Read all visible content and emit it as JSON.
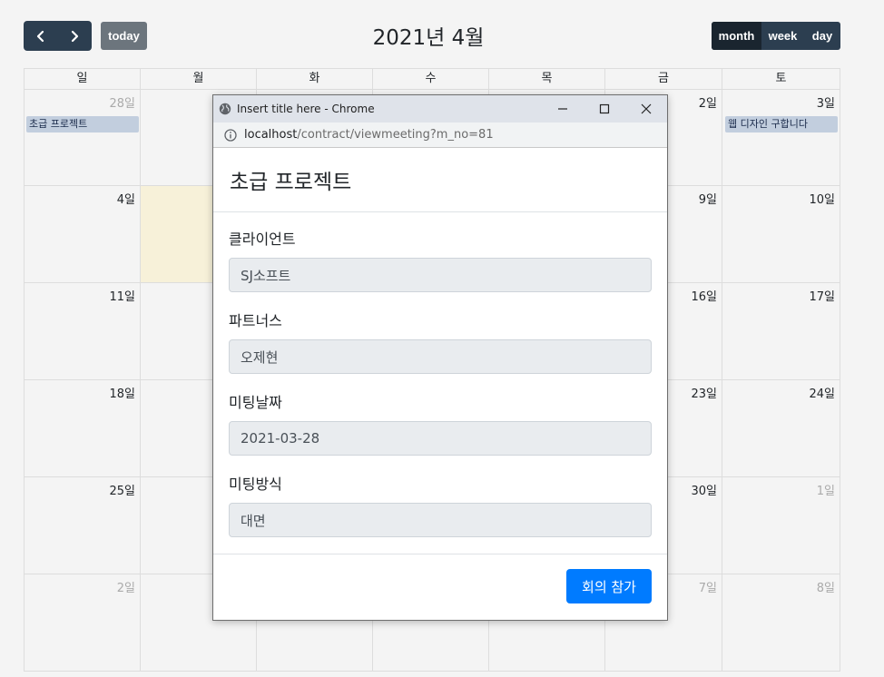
{
  "toolbar": {
    "prev_icon": "chevron-left-icon",
    "next_icon": "chevron-right-icon",
    "today_label": "today",
    "title": "2021년 4월",
    "views": [
      "month",
      "week",
      "day"
    ]
  },
  "calendar": {
    "weekdays": [
      "일",
      "월",
      "화",
      "수",
      "목",
      "금",
      "토"
    ],
    "weeks": [
      [
        "28일",
        "",
        "",
        "",
        "",
        "2일",
        "3일"
      ],
      [
        "4일",
        "",
        "",
        "",
        "",
        "9일",
        "10일"
      ],
      [
        "11일",
        "",
        "",
        "",
        "",
        "16일",
        "17일"
      ],
      [
        "18일",
        "",
        "",
        "",
        "",
        "23일",
        "24일"
      ],
      [
        "25일",
        "",
        "",
        "",
        "",
        "30일",
        "1일"
      ],
      [
        "2일",
        "",
        "",
        "",
        "",
        "7일",
        "8일"
      ]
    ],
    "events": [
      {
        "title": "초급 프로젝트"
      },
      {
        "title": "웹 디자인 구합니다"
      }
    ]
  },
  "popup": {
    "window_title": "Insert title here - Chrome",
    "url_host": "localhost",
    "url_path": "/contract/viewmeeting?m_no=81",
    "modal_title": "초급 프로젝트",
    "fields": [
      {
        "label": "클라이언트",
        "value": "SJ소프트"
      },
      {
        "label": "파트너스",
        "value": "오제현"
      },
      {
        "label": "미팅날짜",
        "value": "2021-03-28"
      },
      {
        "label": "미팅방식",
        "value": "대면"
      }
    ],
    "join_label": "회의 참가"
  },
  "colors": {
    "nav_bg": "#2c3e50",
    "active_view_bg": "#1a252f",
    "today_btn_bg": "#6c757d",
    "today_cell_bg": "#f7f1d9",
    "event_bg": "#c2cede",
    "primary": "#007bff"
  }
}
